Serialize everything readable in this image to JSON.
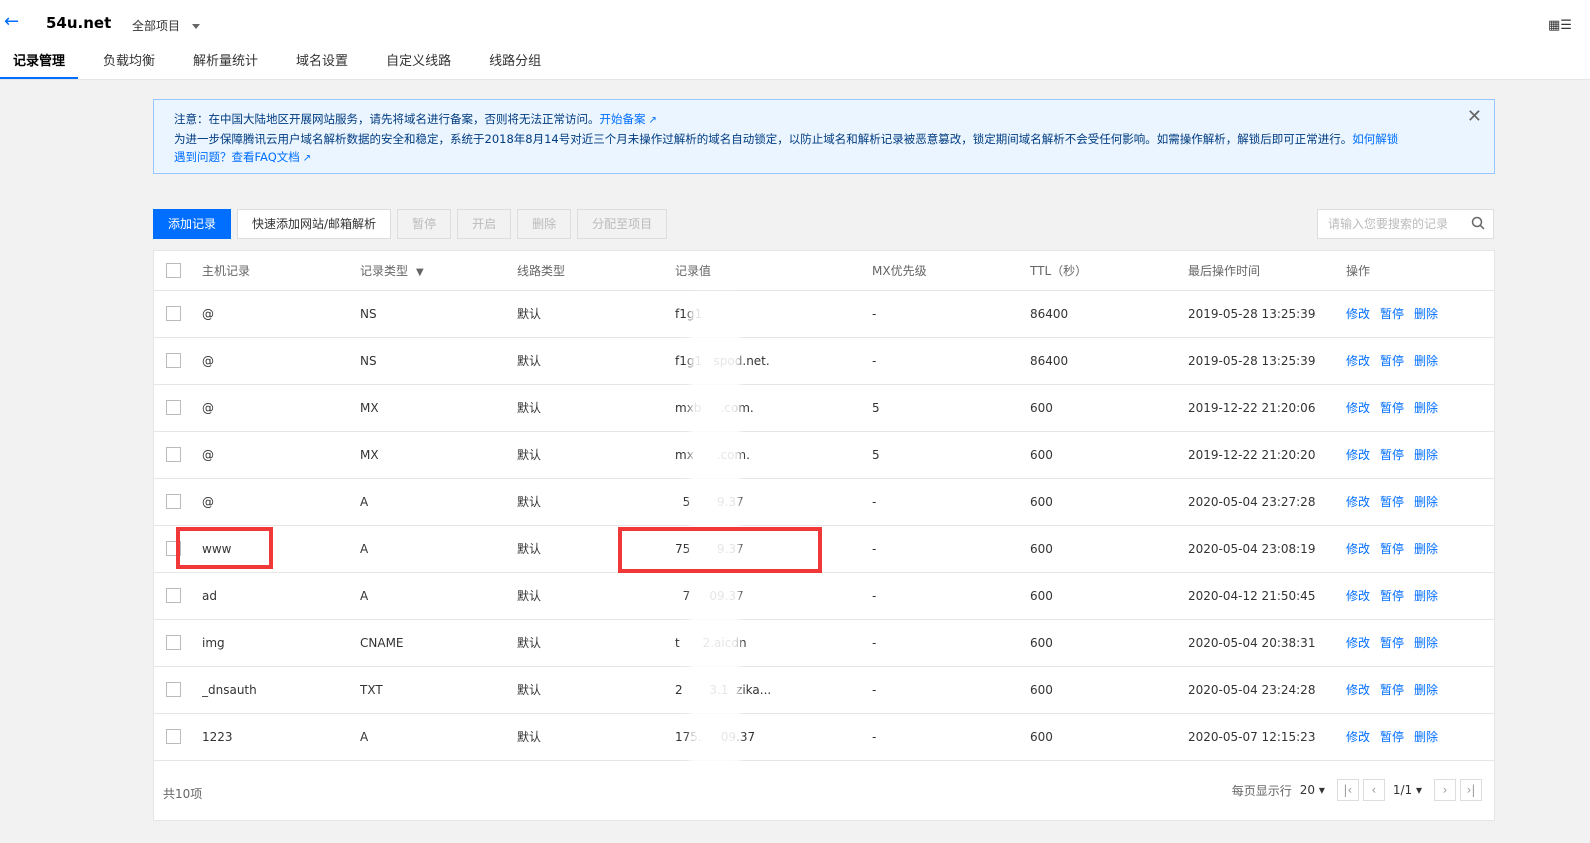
{
  "header": {
    "back_icon": "arrow-left-icon",
    "domain": "54u.net",
    "project": "全部项目",
    "tabs": [
      "记录管理",
      "负载均衡",
      "解析量统计",
      "域名设置",
      "自定义线路",
      "线路分组"
    ],
    "active_tab": 0
  },
  "notice": {
    "line1_text": "注意：在中国大陆地区开展网站服务，请先将域名进行备案，否则将无法正常访问。",
    "line1_link": "开始备案",
    "line2_text": "为进一步保障腾讯云用户域名解析数据的安全和稳定，系统于2018年8月14号对近三个月未操作过解析的域名自动锁定，以防止域名和解析记录被恶意篡改，锁定期间域名解析不会受任何影响。如需操作解析，解锁后即可正常进行。",
    "line2_link": "如何解锁",
    "line3_link": "遇到问题？查看FAQ文档"
  },
  "toolbar": {
    "add": "添加记录",
    "quick_add": "快速添加网站/邮箱解析",
    "pause": "暂停",
    "enable": "开启",
    "delete": "删除",
    "assign": "分配至项目",
    "search_placeholder": "请输入您要搜索的记录"
  },
  "table": {
    "headers": [
      "主机记录",
      "记录类型",
      "线路类型",
      "记录值",
      "MX优先级",
      "TTL（秒）",
      "最后操作时间",
      "操作"
    ],
    "ops": [
      "修改",
      "暂停",
      "删除"
    ],
    "rows": [
      {
        "host": "@",
        "type": "NS",
        "line": "默认",
        "value": "f1g1",
        "mx": "-",
        "ttl": "86400",
        "time": "2019-05-28 13:25:39"
      },
      {
        "host": "@",
        "type": "NS",
        "line": "默认",
        "value": "f1g1   spod.net.",
        "mx": "-",
        "ttl": "86400",
        "time": "2019-05-28 13:25:39"
      },
      {
        "host": "@",
        "type": "MX",
        "line": "默认",
        "value": "mxb     .com.",
        "mx": "5",
        "ttl": "600",
        "time": "2019-12-22 21:20:06"
      },
      {
        "host": "@",
        "type": "MX",
        "line": "默认",
        "value": "mx      .com.",
        "mx": "5",
        "ttl": "600",
        "time": "2019-12-22 21:20:20"
      },
      {
        "host": "@",
        "type": "A",
        "line": "默认",
        "value": "  5       9.37",
        "mx": "-",
        "ttl": "600",
        "time": "2020-05-04 23:27:28"
      },
      {
        "host": "www",
        "type": "A",
        "line": "默认",
        "value": "75       9.37",
        "mx": "-",
        "ttl": "600",
        "time": "2020-05-04 23:08:19"
      },
      {
        "host": "ad",
        "type": "A",
        "line": "默认",
        "value": "  7     09.37",
        "mx": "-",
        "ttl": "600",
        "time": "2020-04-12 21:50:45"
      },
      {
        "host": "img",
        "type": "CNAME",
        "line": "默认",
        "value": "t      2.aicdn",
        "mx": "-",
        "ttl": "600",
        "time": "2020-05-04 20:38:31"
      },
      {
        "host": "_dnsauth",
        "type": "TXT",
        "line": "默认",
        "value": "2       3.1  zika...",
        "mx": "-",
        "ttl": "600",
        "time": "2020-05-04 23:24:28"
      },
      {
        "host": "1223",
        "type": "A",
        "line": "默认",
        "value": "175.     09.37",
        "mx": "-",
        "ttl": "600",
        "time": "2020-05-07 12:15:23"
      }
    ]
  },
  "footer": {
    "total": "共10项",
    "per_page_label": "每页显示行",
    "per_page": "20",
    "page_info": "1/1"
  },
  "colors": {
    "accent": "#006eff",
    "highlight": "#f03838"
  }
}
